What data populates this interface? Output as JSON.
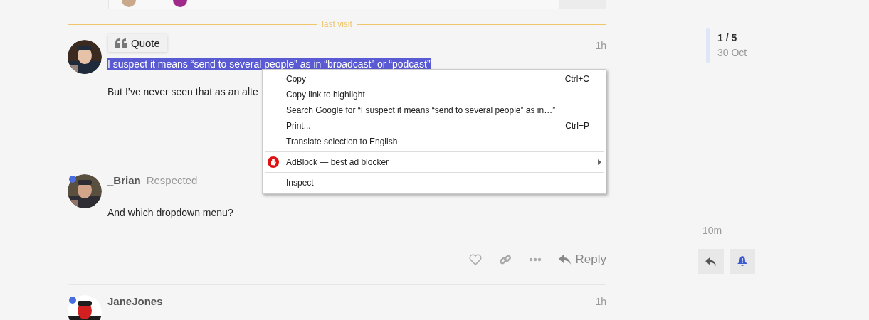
{
  "divider_label": "last visit",
  "posts": [
    {
      "online": false,
      "time": "1h",
      "quote_button": "Quote",
      "paragraphs": [
        {
          "text": "I suspect it means “send to several people” as in “broadcast” or “podcast”",
          "selected": true
        },
        {
          "text": "But I’ve never seen that as an alte",
          "selected": false
        }
      ]
    },
    {
      "online": true,
      "username": "_Brian",
      "user_title": "Respected",
      "paragraphs": [
        {
          "text": "And which dropdown menu?",
          "selected": false
        }
      ],
      "actions": {
        "reply": "Reply"
      }
    },
    {
      "online": true,
      "username": "JaneJones",
      "time": "1h"
    }
  ],
  "context_menu": [
    {
      "kind": "item",
      "label": "Copy",
      "shortcut": "Ctrl+C"
    },
    {
      "kind": "item",
      "label": "Copy link to highlight"
    },
    {
      "kind": "item",
      "label": "Search Google for “I suspect it means “send to several people” as in…”"
    },
    {
      "kind": "item",
      "label": "Print...",
      "shortcut": "Ctrl+P"
    },
    {
      "kind": "item",
      "label": "Translate selection to English"
    },
    {
      "kind": "separator"
    },
    {
      "kind": "extension",
      "label": "AdBlock — best ad blocker",
      "submenu": true
    },
    {
      "kind": "separator"
    },
    {
      "kind": "item",
      "label": "Inspect"
    }
  ],
  "timeline": {
    "position": "1 / 5",
    "date": "30 Oct",
    "last": "10m"
  }
}
